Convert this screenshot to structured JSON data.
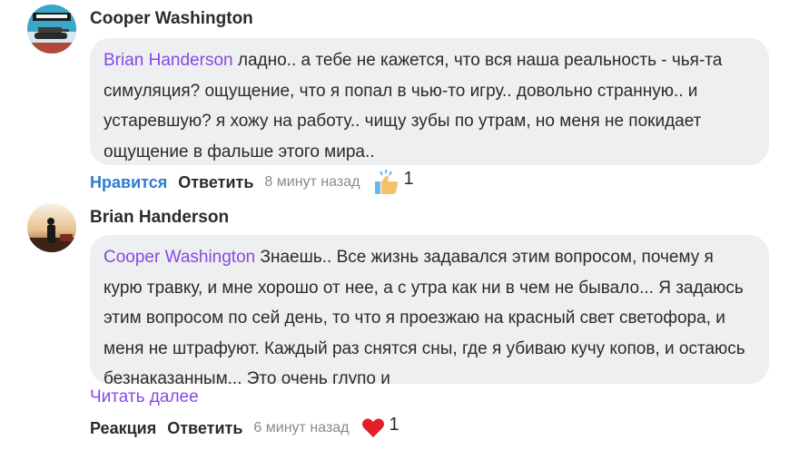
{
  "comments": [
    {
      "author": "Cooper Washington",
      "mention": "Brian Handerson",
      "text": " ладно.. а тебе не кажется, что вся наша реальность - чья-та симуляция? ощущение, что я попал в чью-то игру.. довольно странную.. и устаревшую? я хожу на работу.. чищу зубы по утрам, но меня не покидает ощущение в фальше этого мира..",
      "like_label": "Нравится",
      "reply_label": "Ответить",
      "time": "8 минут назад",
      "reaction_icon": "thumbs-up-sparkle-icon",
      "reaction_count": "1"
    },
    {
      "author": "Brian Handerson",
      "mention": "Cooper Washington",
      "text": " Знаешь.. Все жизнь задавался этим вопросом, почему я курю травку, и мне хорошо от нее, а с утра как ни в чем не бывало... Я задаюсь этим вопросом по сей день, то что я проезжаю на красный свет светофора, и меня не штрафуют. Каждый раз снятся сны, где я убиваю кучу копов, и остаюсь безнаказанным... Это очень глупо и",
      "read_more": "Читать далее",
      "react_label": "Реакция",
      "reply_label": "Ответить",
      "time": "6 минут назад",
      "reaction_icon": "heart-icon",
      "reaction_count": "1"
    }
  ],
  "colors": {
    "accent_link": "#2e7bd2",
    "mention": "#8a48e6",
    "bubble": "#eeeff1",
    "heart": "#e0202b"
  }
}
